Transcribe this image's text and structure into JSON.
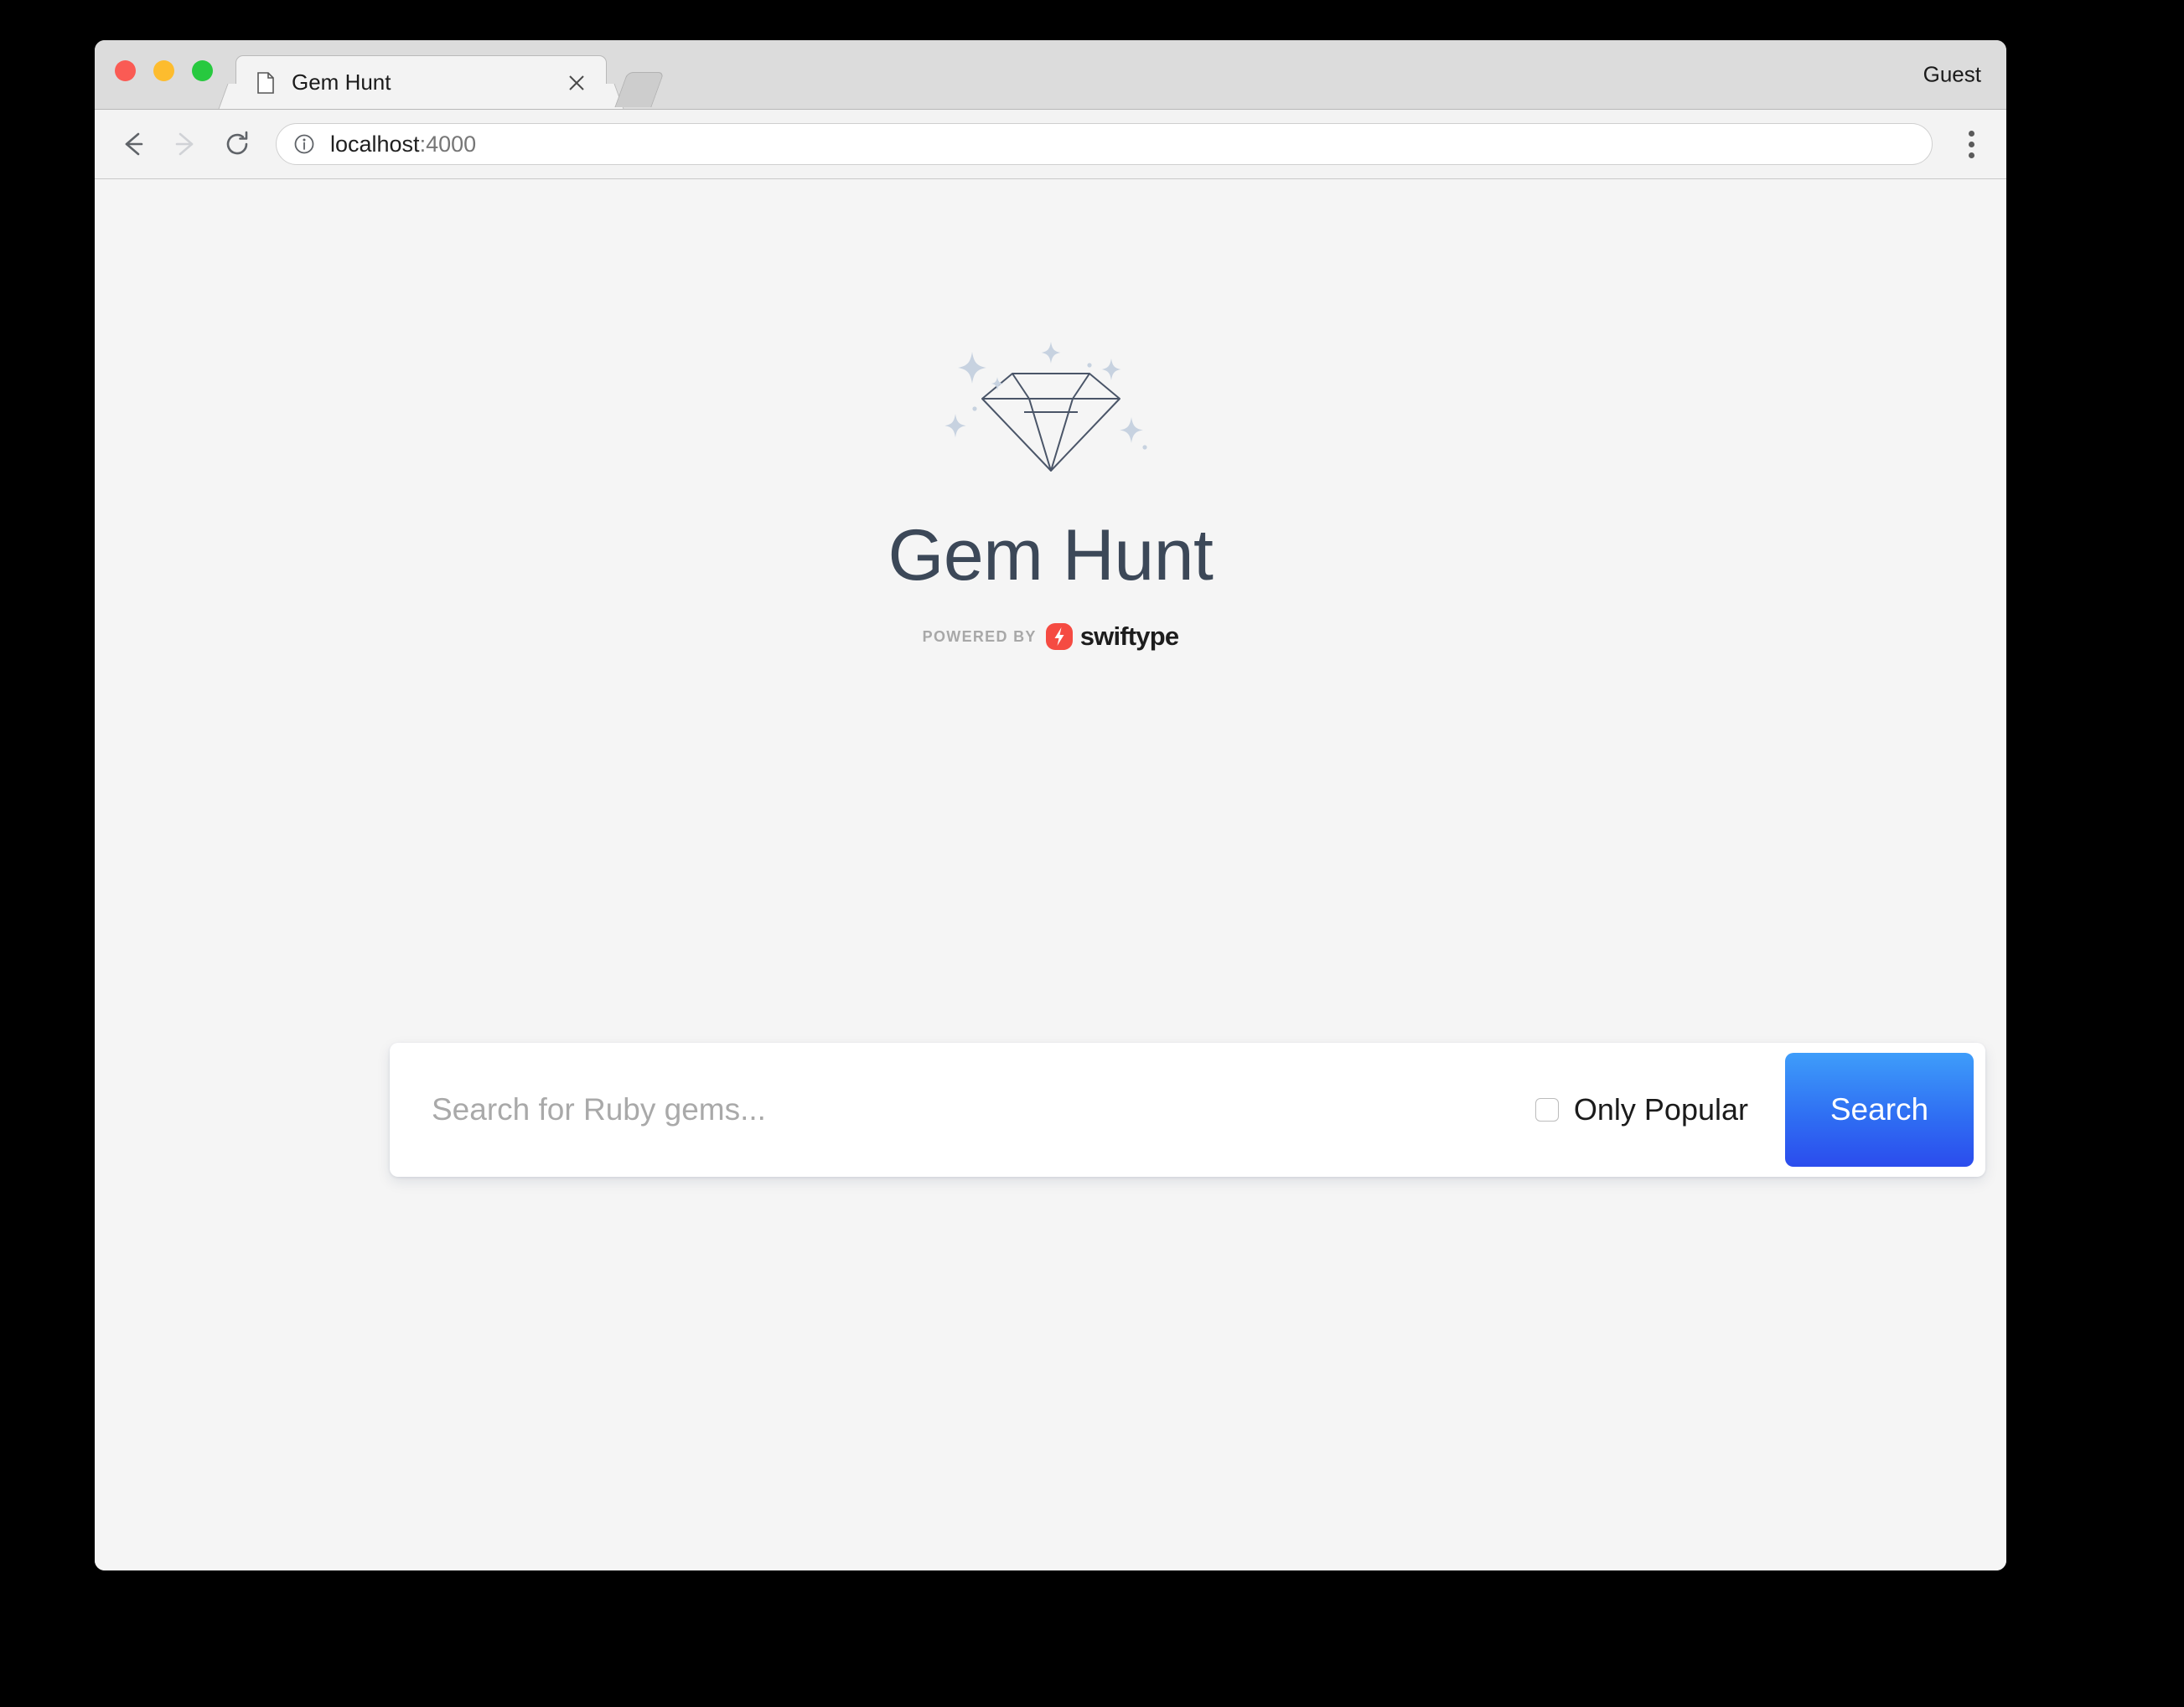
{
  "browser": {
    "tab": {
      "title": "Gem Hunt",
      "favicon_icon": "page-icon",
      "close_icon": "close-icon"
    },
    "new_tab_icon": "new-tab-button",
    "profile_label": "Guest",
    "toolbar": {
      "back_icon": "back-arrow-icon",
      "forward_icon": "forward-arrow-icon",
      "reload_icon": "reload-icon",
      "menu_icon": "overflow-menu-icon",
      "security_icon": "info-circle-icon",
      "url_host": "localhost",
      "url_port": ":4000"
    },
    "window_controls": {
      "close_color": "#fa5b54",
      "minimize_color": "#fdbc2e",
      "zoom_color": "#27c93f"
    }
  },
  "page": {
    "background_color": "#f5f5f5",
    "logo_icon": "diamond-gem-icon",
    "logo_stroke_color": "#4a5568",
    "sparkle_color": "#c7d2e0",
    "title": "Gem Hunt",
    "title_color": "#3c4858",
    "powered_by": {
      "prefix": "POWERED BY",
      "brand": "swiftype",
      "mark_icon": "lightning-bolt-icon",
      "mark_color": "#f54b42"
    },
    "search": {
      "placeholder": "Search for Ruby gems...",
      "value": "",
      "only_popular_label": "Only Popular",
      "only_popular_checked": false,
      "submit_label": "Search",
      "submit_color_top": "#3e9dfa",
      "submit_color_bottom": "#2b4ced"
    }
  }
}
